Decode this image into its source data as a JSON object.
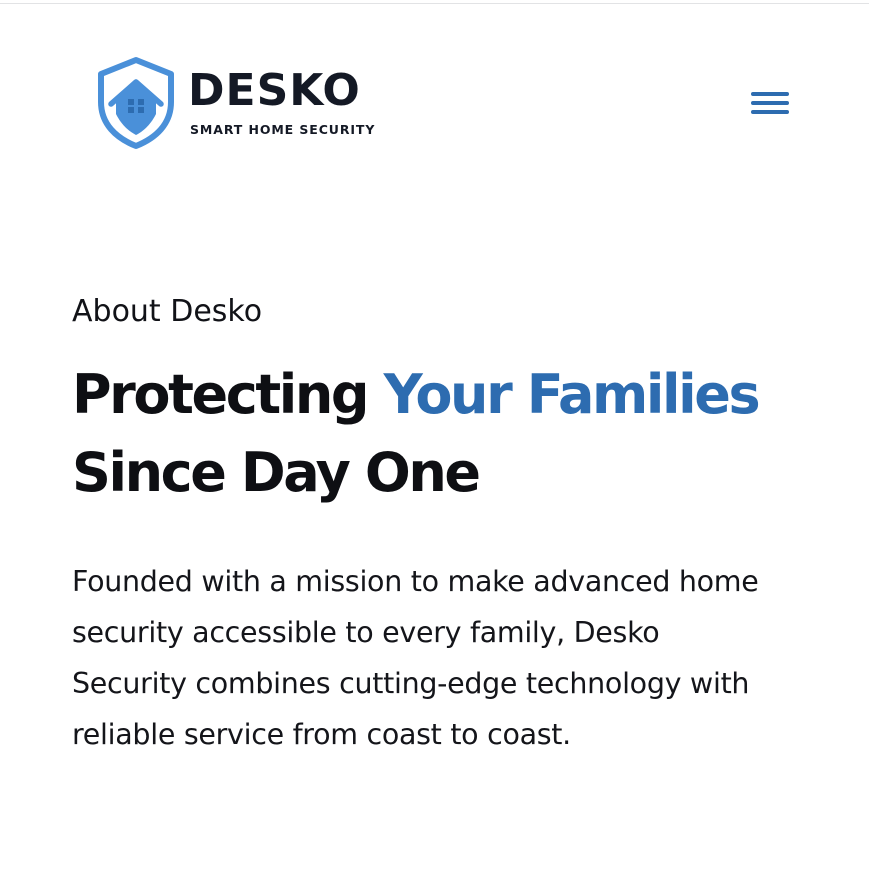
{
  "header": {
    "logo": {
      "name": "DESKO",
      "tagline": "SMART HOME SECURITY",
      "icon": "shield-house-icon"
    },
    "menu_icon": "hamburger-menu-icon"
  },
  "about": {
    "eyebrow": "About Desko",
    "headline": {
      "line1_part1": "Protecting ",
      "line1_accent": "Your Families",
      "line2": "Since Day One"
    },
    "description_lines": [
      "Founded with a mission to make advanced home",
      "security accessible to every family, Desko",
      "Security combines cutting-edge technology with",
      "reliable service from coast to coast."
    ]
  },
  "colors": {
    "accent": "#2d6cb0",
    "shield": "#4a90d9",
    "text_dark": "#111217",
    "background": "#ffffff"
  }
}
